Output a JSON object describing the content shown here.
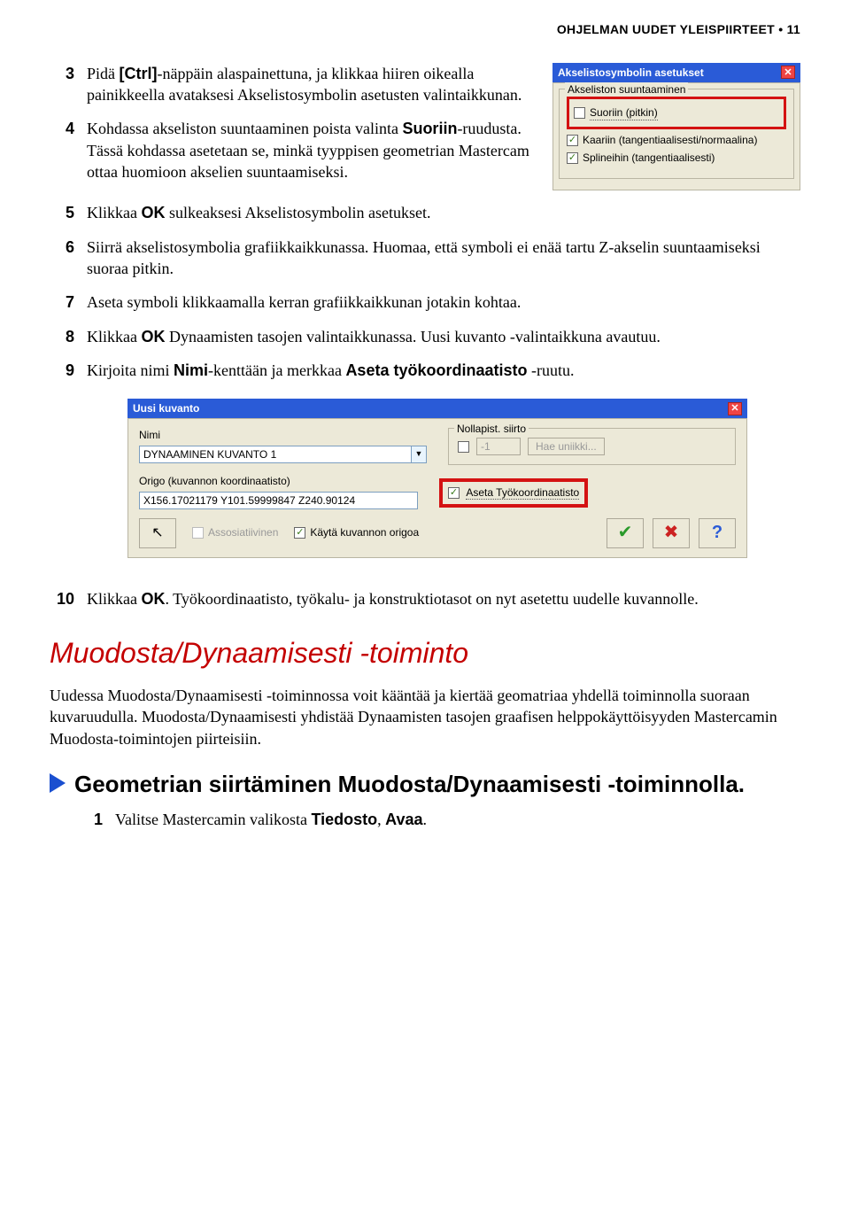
{
  "header": {
    "text": "OHJELMAN UUDET YLEISPIIRTEET • 11"
  },
  "steps_a": [
    {
      "num": "3",
      "pre": "Pidä ",
      "bold1": "[Ctrl]",
      "post": "-näppäin alaspainettuna, ja klikkaa hiiren oikealla painikkeella avataksesi Akselistosymbolin asetusten valintaikkunan."
    },
    {
      "num": "4",
      "pre": "Kohdassa akseliston suuntaaminen poista valinta ",
      "bold1": "Suoriin",
      "post": "-ruudusta. Tässä kohdassa asetetaan se, minkä tyyppisen geometrian Mastercam ottaa huomioon akselien suuntaamiseksi."
    }
  ],
  "dialog1": {
    "title": "Akselistosymbolin asetukset",
    "legend": "Akseliston suuntaaminen",
    "opt_suoriin": "Suoriin (pitkin)",
    "opt_kaariin": "Kaariin (tangentiaalisesti/normaalina)",
    "opt_spline": "Splineihin (tangentiaalisesti)"
  },
  "steps_b": [
    {
      "num": "5",
      "parts": [
        {
          "t": "Klikkaa "
        },
        {
          "b": "OK"
        },
        {
          "t": " sulkeaksesi Akselistosymbolin asetukset."
        }
      ]
    },
    {
      "num": "6",
      "parts": [
        {
          "t": "Siirrä akselistosymbolia grafiikkaikkunassa. Huomaa, että symboli ei enää tartu Z-akselin suuntaamiseksi suoraa pitkin."
        }
      ]
    },
    {
      "num": "7",
      "parts": [
        {
          "t": "Aseta symboli klikkaamalla kerran grafiikkaikkunan jotakin kohtaa."
        }
      ]
    },
    {
      "num": "8",
      "parts": [
        {
          "t": "Klikkaa "
        },
        {
          "b": "OK"
        },
        {
          "t": " Dynaamisten tasojen valintaikkunassa. Uusi kuvanto -valintaikkuna avautuu."
        }
      ]
    },
    {
      "num": "9",
      "parts": [
        {
          "t": "Kirjoita nimi "
        },
        {
          "b": "Nimi"
        },
        {
          "t": "-kenttään ja merkkaa "
        },
        {
          "b": "Aseta työkoordinaatisto"
        },
        {
          "t": " -ruutu."
        }
      ]
    }
  ],
  "dialog2": {
    "title": "Uusi kuvanto",
    "nimi_label": "Nimi",
    "nimi_value": "DYNAAMINEN KUVANTO 1",
    "origo_label": "Origo (kuvannon koordinaatisto)",
    "origo_value": "X156.17021179 Y101.59999847 Z240.90124",
    "nolla_legend": "Nollapist. siirto",
    "nolla_value": "-1",
    "hae_btn": "Hae uniikki...",
    "aseta_label": "Aseta Työkoordinaatisto",
    "assos_label": "Assosiatiivinen",
    "kayta_label": "Käytä kuvannon origoa"
  },
  "steps_c": [
    {
      "num": "10",
      "parts": [
        {
          "t": "Klikkaa "
        },
        {
          "b": "OK"
        },
        {
          "t": ". Työkoordinaatisto, työkalu- ja konstruktiotasot on nyt asetettu uudelle kuvannolle."
        }
      ]
    }
  ],
  "section_title": "Muodosta/Dynaamisesti -toiminto",
  "section_para": "Uudessa Muodosta/Dynaamisesti -toiminnossa voit kääntää ja kiertää geomatriaa yhdellä toiminnolla suoraan kuvaruudulla. Muodosta/Dynaamisesti yhdistää Dynaamisten tasojen graafisen helppokäyttöisyyden Mastercamin Muodosta-toimintojen piirteisiin.",
  "sub_title": "Geometrian siirtäminen Muodosta/Dynaamisesti -toiminnolla.",
  "steps_d": [
    {
      "num": "1",
      "parts": [
        {
          "t": "Valitse Mastercamin valikosta "
        },
        {
          "b": "Tiedosto"
        },
        {
          "t": ", "
        },
        {
          "b": "Avaa"
        },
        {
          "t": "."
        }
      ]
    }
  ]
}
